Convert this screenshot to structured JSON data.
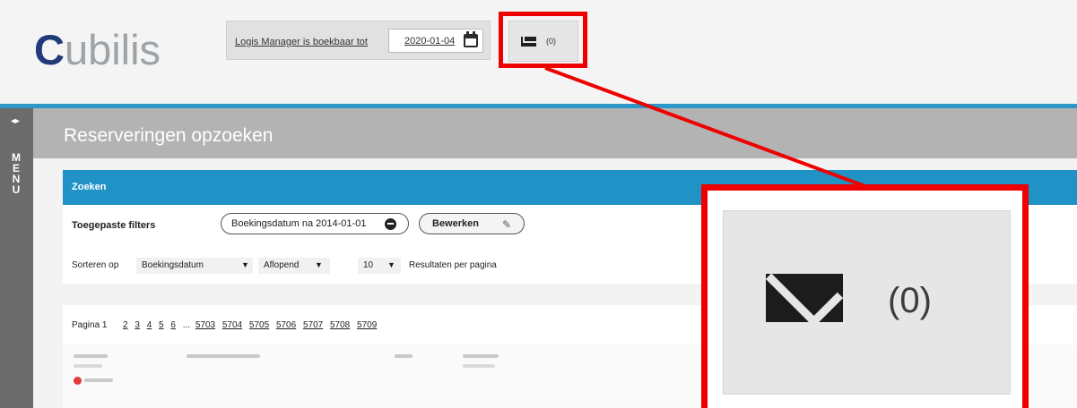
{
  "brand": {
    "logo_first": "C",
    "logo_rest": "ubilis"
  },
  "header": {
    "booking_link": "Logis Manager is boekbaar tot",
    "date_value": "2020-01-04",
    "messages_count": "(0)"
  },
  "sidemenu": {
    "toggle": "◂▸",
    "label": "MENU"
  },
  "page": {
    "title": "Reserveringen opzoeken"
  },
  "search": {
    "panel_title": "Zoeken",
    "filters_label": "Toegepaste filters",
    "active_filter": "Boekingsdatum na 2014-01-01",
    "edit_label": "Bewerken",
    "sort_label": "Sorteren op",
    "sort_field": "Boekingsdatum",
    "sort_order": "Aflopend",
    "per_page": "10",
    "per_page_label": "Resultaten per pagina"
  },
  "pager": {
    "label": "Pagina 1",
    "pages": [
      "2",
      "3",
      "4",
      "5",
      "6"
    ],
    "ellipsis": "...",
    "last_pages": [
      "5703",
      "5704",
      "5705",
      "5706",
      "5707",
      "5708",
      "5709"
    ]
  },
  "zoom": {
    "count": "(0)"
  },
  "colors": {
    "accent": "#2192c6",
    "highlight": "#ee0000",
    "logo_blue": "#203a7a"
  }
}
